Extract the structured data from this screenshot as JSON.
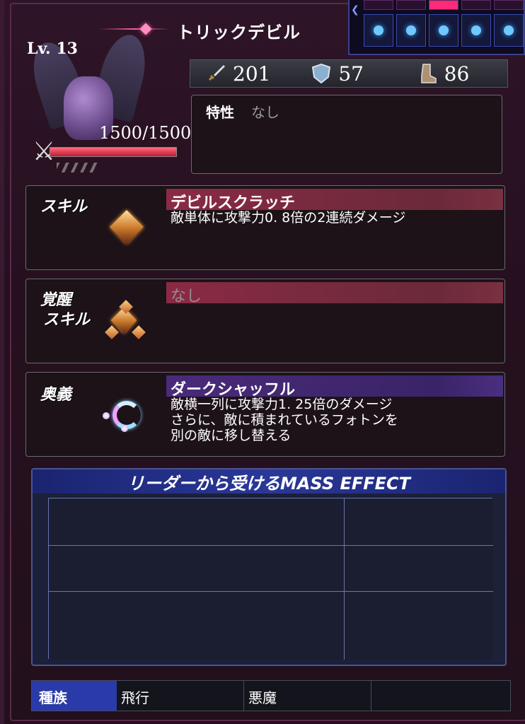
{
  "header": {
    "title": "トリックデビル"
  },
  "character": {
    "level": "Lv. 13",
    "hp": "1500/1500",
    "hp_fraction": 1.0
  },
  "stats": [
    {
      "icon": "sword-icon",
      "value": "201"
    },
    {
      "icon": "shield-icon",
      "value": "57"
    },
    {
      "icon": "boot-icon",
      "value": "86"
    }
  ],
  "trait": {
    "label": "特性",
    "value": "なし"
  },
  "skill": {
    "label": "スキル",
    "name": "デビルスクラッチ",
    "desc": "敵単体に攻撃力0. 8倍の2連続ダメージ"
  },
  "awaken": {
    "label_line1": "覚醒",
    "label_line2": "スキル",
    "name": "なし"
  },
  "ougi": {
    "label": "奥義",
    "name": "ダークシャッフル",
    "desc_line1": "敵横一列に攻撃力1. 25倍のダメージ",
    "desc_line2": "さらに、敵に積まれているフォトンを",
    "desc_line3": "別の敵に移し替える"
  },
  "mass_effect": {
    "title": "リーダーから受けるMASS EFFECT"
  },
  "tribe": {
    "label": "種族",
    "values": [
      "飛行",
      "悪魔",
      ""
    ]
  }
}
